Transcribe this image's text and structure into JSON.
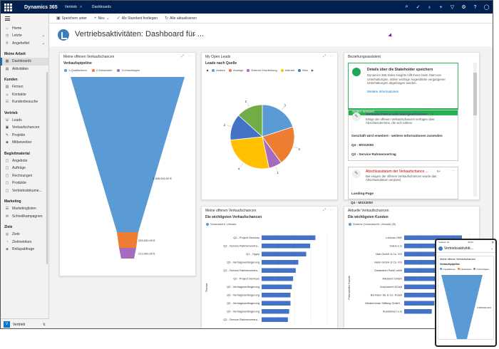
{
  "app": {
    "brand": "Dynamics 365",
    "breadcrumb_area": "Vertrieb",
    "breadcrumb_page": "Dashboards"
  },
  "commands": {
    "save_as": "Speichern unter",
    "new": "Neu",
    "set_default": "Als Standard festlegen",
    "refresh": "Alle aktualisieren"
  },
  "sidebar": {
    "top": [
      {
        "label": "Home"
      },
      {
        "label": "Letzte"
      },
      {
        "label": "Angeheftet"
      }
    ],
    "groups": [
      {
        "heading": "Meine Arbeit",
        "items": [
          {
            "label": "Dashboards",
            "active": true
          },
          {
            "label": "Aktivitäten"
          }
        ]
      },
      {
        "heading": "Kunden",
        "items": [
          {
            "label": "Firmen"
          },
          {
            "label": "Kontakte"
          },
          {
            "label": "Kundenbesuche"
          }
        ]
      },
      {
        "heading": "Vertrieb",
        "items": [
          {
            "label": "Leads"
          },
          {
            "label": "Verkaufschancen"
          },
          {
            "label": "Projekte"
          },
          {
            "label": "Mitbewerber"
          }
        ]
      },
      {
        "heading": "Begleitmaterial",
        "items": [
          {
            "label": "Angebote"
          },
          {
            "label": "Aufträge"
          },
          {
            "label": "Rechnungen"
          },
          {
            "label": "Produkte"
          },
          {
            "label": "Vertriebsdokume..."
          }
        ]
      },
      {
        "heading": "Marketing",
        "items": [
          {
            "label": "Marketinglisten"
          },
          {
            "label": "Schnellkampagnen"
          }
        ]
      },
      {
        "heading": "Ziele",
        "items": [
          {
            "label": "Ziele"
          },
          {
            "label": "Zielmetriken"
          },
          {
            "label": "Rollupabfrage"
          }
        ]
      }
    ],
    "area_badge": "V",
    "area_label": "Vertrieb"
  },
  "page": {
    "title": "Vertriebsaktivitäten: Dashboard für ..."
  },
  "panels": {
    "funnel": {
      "title": "Meine offenen Verkaufschancen",
      "subtitle": "Verkaufspipeline"
    },
    "leads": {
      "title": "My Open Leads",
      "subtitle": "Leads nach Quelle"
    },
    "assistant": {
      "title": "Beziehungsassistent",
      "card1_title": "Details über die Stakeholder speichern",
      "card1_body": "Dynamics 365 Sales Insights hilft Ihnen beim Start von Unterhaltungen, indem wichtige Augenblicke vergangener Unterhaltungen abgefangen werden.",
      "card1_link": "Weitere Informationen",
      "card1_action": "Später erinnern",
      "card2_title": "Verkaufschance wird bald geschlossen",
      "card2_count": "3",
      "card2_body": "Einige der offenen Verkaufschancen verfügen über Abschlusstermine, die sich nähern",
      "card2_rows": [
        "Geschäft wird erweitert - weitere Informationen zusenden",
        "Q4 - MSX2000",
        "Q2 - Service Rahmenvertrag"
      ],
      "card3_title": "Abschlussdatum der Verkaufschance ...",
      "card3_count": "5+",
      "card3_body": "Bei einigen der offenen Verkaufschancen wurde das Abschlussdatum verpasst",
      "card3_rows": [
        "Landing-Page",
        "Q4 - MSX2000"
      ]
    },
    "opps": {
      "title": "Meine offenen Verkaufschancen",
      "subtitle": "Die wichtigsten Verkaufschancen",
      "legend": "Voraussicht. Umsatz",
      "axis_label": "Thema"
    },
    "current": {
      "title": "Aktuelle Verkaufschancen",
      "subtitle": "Die wichtigsten Kunden",
      "legend": "Summe (Voraussicht. Umsatz) (€)",
      "axis_label": "Potenzieller Kunde"
    }
  },
  "phone": {
    "status_left": "Telekom.de",
    "status_time": "09:41",
    "title": "Vertriebsaktivität...",
    "panel_title": "Meine offenen Verkaufschancen",
    "subtitle": "Verkaufspipeline",
    "legend": [
      "1-Qualifizieren",
      "2-Entwickeln",
      "3-Vorschlagen"
    ],
    "value": "3.368.000,00 €"
  },
  "colors": {
    "blue": "#5b9bd5",
    "orange": "#ed7d31",
    "purple": "#a66bbe",
    "green": "#70ad47",
    "yellow": "#ffc000",
    "navy": "#4472c4",
    "topbar": "#002050"
  },
  "chart_data": [
    {
      "type": "funnel",
      "title": "Verkaufspipeline",
      "categories": [
        "1-Qualifizieren",
        "2-Entwickeln",
        "3-Vorschlagen"
      ],
      "values": [
        3368000,
        259000,
        212000
      ],
      "labels": [
        "3.368.000,00 €",
        "259.000,00 €",
        "212.000,00 €"
      ]
    },
    {
      "type": "pie",
      "title": "Leads nach Quelle",
      "categories": [
        "Andere",
        "Anzeige",
        "Externe Empfehlung",
        "Internet",
        "Mes"
      ],
      "values": [
        3,
        3,
        1,
        4,
        2,
        2
      ],
      "slice_colors": [
        "#5b9bd5",
        "#ed7d31",
        "#a66bbe",
        "#ffc000",
        "#4472c4",
        "#70ad47"
      ],
      "legend_visible": [
        "Andere",
        "Anzeige",
        "Externe Empfehlung",
        "Internet",
        "Mes"
      ]
    },
    {
      "type": "bar",
      "title": "Die wichtigsten Verkaufschancen",
      "categories": [
        "Q2 - Project Services",
        "Q2 - Service Rahmenvertra...",
        "Q1 - Opply",
        "Q3 - Vertragsverlängerung",
        "Q2 - Service Rahmenvertra...",
        "Q2 - Project Services",
        "Q3 - Vertragsverlängerung",
        "Q3 - Vertragsverlängerung",
        "Q3 - Vertragsverlängerung",
        "Q3 - Vertragsverlängerung",
        "Q2 - Service Rahmenvertra..."
      ],
      "values": [
        82,
        74,
        68,
        56,
        52,
        48,
        46,
        44,
        44,
        42,
        40
      ]
    },
    {
      "type": "bar",
      "title": "Die wichtigsten Kunden",
      "categories": [
        "Lobmus GbR",
        "Gaius e.G",
        "Nair GmbH & Co. KG",
        "Hahn GmbH & Co. KG",
        "Zastenberl PartG mbB",
        "Allenbert GmbH",
        "Auszusenrt KGaA",
        "Bormann SE & Co. KGaA",
        "Mödermman Stiftung GmbH...",
        "Ausdehnen e.G"
      ],
      "values": [
        88,
        80,
        74,
        70,
        64,
        60,
        56,
        50,
        46,
        42
      ]
    }
  ]
}
